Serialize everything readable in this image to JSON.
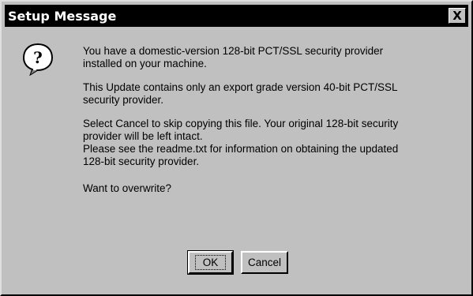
{
  "window": {
    "title": "Setup Message",
    "close_glyph": "X"
  },
  "icon": {
    "name": "question-icon",
    "glyph": "?"
  },
  "message": {
    "para1_line1": "You have a domestic-version 128-bit PCT/SSL security provider",
    "para1_line2": "installed on your machine.",
    "para2_line1": "This Update contains only an export grade version 40-bit PCT/SSL",
    "para2_line2": "security provider.",
    "para3_line1": "Select Cancel to skip copying this file.  Your original 128-bit security",
    "para3_line2": "provider will be left intact.",
    "para4_line1": "Please see the readme.txt for information on obtaining the updated",
    "para4_line2": "128-bit security provider.",
    "question": "Want to overwrite?"
  },
  "buttons": {
    "ok_label": "OK",
    "cancel_label": "Cancel"
  }
}
